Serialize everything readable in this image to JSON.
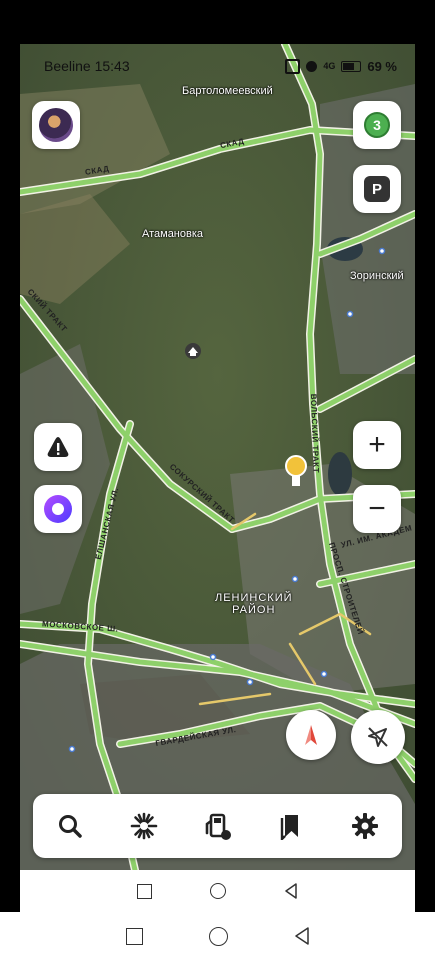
{
  "status_bar": {
    "carrier_time": "Beeline 15:43",
    "network": "4G",
    "battery": "69 %"
  },
  "map": {
    "labels": {
      "bartolomeevsky": "Бартоломеевский",
      "atamanovka": "Атамановка",
      "zorinsky": "Зоринский",
      "leninsky": "ЛЕНИНСКИЙ\nРАЙОН"
    },
    "roads": {
      "skad1": "СКАД",
      "skad2": "СКАД",
      "sokursky": "СОКУРСКИЙ ТРАКТ",
      "volsky": "ВОЛЬСКИЙ ТРАКТ",
      "moskovskoe": "МОСКОВСКОЕ Ш.",
      "gvardeyskaya": "ГВАРДЕЙСКАЯ УЛ.",
      "stroiteley": "ПРОСП. СТРОИТЕЛЕЙ",
      "akadem": "УЛ. ИМ. АКАДЕМ",
      "elshanskaya": "ЕЛШАНСКАЯ УЛ.",
      "trakt_left": "СКИЙ ТРАКТ"
    },
    "traffic_level": "3",
    "parking_label": "P"
  },
  "buttons": {
    "zoom_in": "+",
    "zoom_out": "−"
  },
  "toolbar": [
    "search-icon",
    "discovery-icon",
    "gas-station-icon",
    "bookmarks-icon",
    "settings-icon"
  ],
  "colors": {
    "road": "#8ed06a",
    "accent_purple": "#7f3fff",
    "traffic_green": "#4caf50",
    "compass_red": "#e0473a"
  }
}
